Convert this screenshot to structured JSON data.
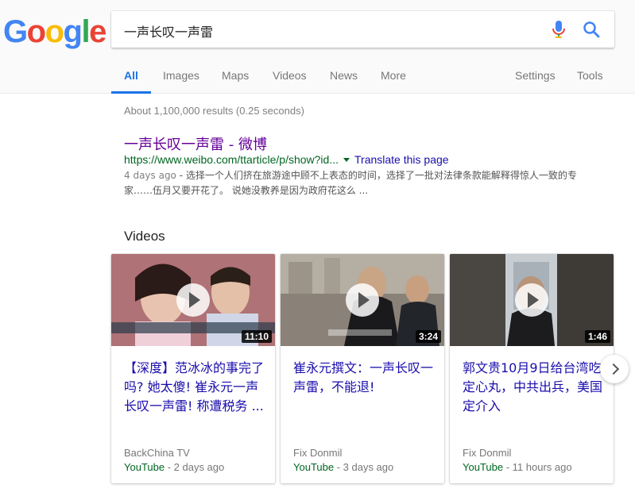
{
  "logo": {
    "letters": [
      "G",
      "o",
      "o",
      "g",
      "l",
      "e"
    ],
    "colors": [
      "#4285f4",
      "#ea4335",
      "#fbbc05",
      "#4285f4",
      "#34a853",
      "#ea4335"
    ]
  },
  "search": {
    "query": "一声长叹一声雷"
  },
  "tabs": {
    "all": "All",
    "images": "Images",
    "maps": "Maps",
    "videos": "Videos",
    "news": "News",
    "more": "More",
    "settings": "Settings",
    "tools": "Tools"
  },
  "stats": "About 1,100,000 results (0.25 seconds)",
  "result": {
    "title_main": "一声长叹一声雷",
    "title_sep": " - ",
    "title_site": "微博",
    "url": "https://www.weibo.com/ttarticle/p/show?id...",
    "translate": "Translate this page",
    "date": "4 days ago",
    "snippet_rest": " - 选择一个人们挤在旅游途中顾不上表态的时间，选择了一批对法律条款能解释得惊人一致的专家……伍月又要开花了。 说她没教养是因为政府花这么 ..."
  },
  "videos": {
    "heading": "Videos",
    "items": [
      {
        "title": "【深度】范冰冰的事完了吗? 她太傻! 崔永元一声长叹一声雷! 称遭税务 ...",
        "duration": "11:10",
        "source": "BackChina TV",
        "platform": "YouTube",
        "age": " - 2 days ago"
      },
      {
        "title": "崔永元撰文：一声长叹一声雷，不能退!",
        "duration": "3:24",
        "source": "Fix Donmil",
        "platform": "YouTube",
        "age": " - 3 days ago"
      },
      {
        "title": "郭文贵10月9日给台湾吃定心丸，中共出兵，美国定介入",
        "duration": "1:46",
        "source": "Fix Donmil",
        "platform": "YouTube",
        "age": " - 11 hours ago"
      }
    ]
  }
}
